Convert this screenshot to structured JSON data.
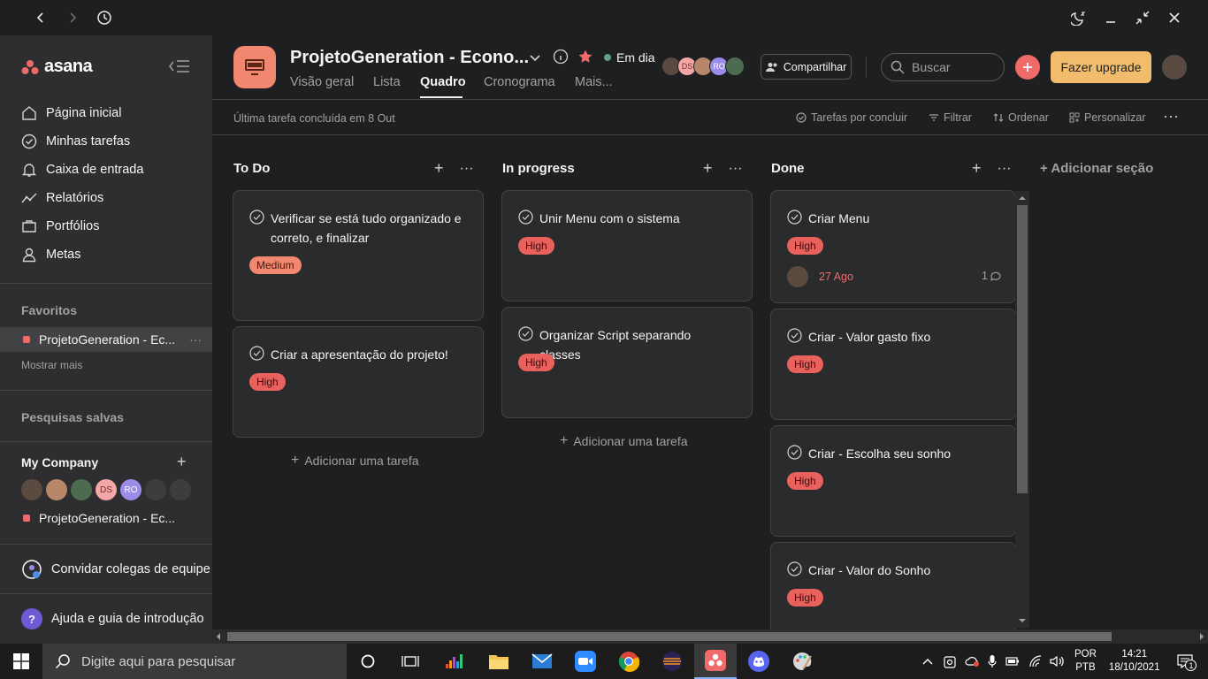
{
  "sidebar": {
    "brand": "asana",
    "nav": [
      "Página inicial",
      "Minhas tarefas",
      "Caixa de entrada",
      "Relatórios",
      "Portfólios",
      "Metas"
    ],
    "favorites_title": "Favoritos",
    "favorite_project": "ProjetoGeneration - Ec...",
    "show_more": "Mostrar mais",
    "saved_searches": "Pesquisas salvas",
    "company": "My Company",
    "company_members": [
      "DS",
      "RO"
    ],
    "company_project": "ProjetoGeneration - Ec...",
    "invite": "Convidar colegas de equipe",
    "help": "Ajuda e guia de introdução"
  },
  "header": {
    "project_title": "ProjetoGeneration - Econo...",
    "status": "Em dia",
    "members": [
      "DS",
      "RO"
    ],
    "share": "Compartilhar",
    "search_placeholder": "Buscar",
    "upgrade": "Fazer upgrade",
    "tabs": [
      "Visão geral",
      "Lista",
      "Quadro",
      "Cronograma",
      "Mais..."
    ],
    "active_tab": "Quadro"
  },
  "toolbar": {
    "last_completed": "Última tarefa concluída em 8 Out",
    "incomplete": "Tarefas por concluir",
    "filter": "Filtrar",
    "sort": "Ordenar",
    "customize": "Personalizar"
  },
  "board": {
    "columns": [
      {
        "title": "To Do",
        "add_task": "Adicionar uma tarefa",
        "cards": [
          {
            "title": "Verificar se está tudo organizado e correto, e finalizar",
            "tag": "Medium"
          },
          {
            "title": "Criar a apresentação do projeto!",
            "tag": "High"
          }
        ]
      },
      {
        "title": "In progress",
        "add_task": "Adicionar uma tarefa",
        "cards": [
          {
            "title": "Unir Menu com o sistema",
            "tag": "High"
          },
          {
            "title": "Organizar Script separando classes",
            "tag": "High"
          }
        ]
      },
      {
        "title": "Done",
        "cards": [
          {
            "title": "Criar Menu",
            "tag": "High",
            "due": "27 Ago",
            "comments": "1"
          },
          {
            "title": "Criar - Valor gasto fixo",
            "tag": "High"
          },
          {
            "title": "Criar - Escolha seu sonho",
            "tag": "High"
          },
          {
            "title": "Criar - Valor do Sonho",
            "tag": "High"
          }
        ]
      }
    ],
    "add_section": "+ Adicionar seção"
  },
  "taskbar": {
    "search_placeholder": "Digite aqui para pesquisar",
    "lang1": "POR",
    "lang2": "PTB",
    "time": "14:21",
    "date": "18/10/2021",
    "notifications": "1"
  },
  "colors": {
    "accent": "#f06a6a",
    "upgrade": "#f1bd6c",
    "bg": "#1e1f21",
    "sidebar": "#2e2e30"
  }
}
